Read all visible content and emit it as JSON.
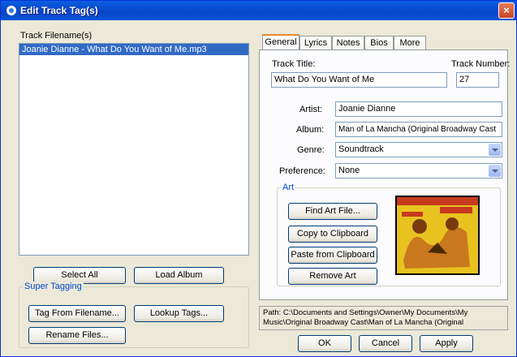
{
  "window": {
    "title": "Edit Track Tag(s)"
  },
  "files": {
    "label": "Track Filename(s)",
    "items": [
      "Joanie Dianne - What Do You Want of Me.mp3"
    ]
  },
  "buttons": {
    "select_all": "Select All",
    "load_album": "Load Album",
    "tag_from_filename": "Tag From Filename...",
    "lookup_tags": "Lookup Tags...",
    "rename_files": "Rename Files...",
    "find_art_file": "Find Art File...",
    "copy_to_clipboard": "Copy to Clipboard",
    "paste_from_clipboard": "Paste from Clipboard",
    "remove_art": "Remove Art",
    "ok": "OK",
    "cancel": "Cancel",
    "apply": "Apply"
  },
  "super_tagging": {
    "label": "Super Tagging"
  },
  "tabs": [
    "General",
    "Lyrics",
    "Notes",
    "Bios",
    "More"
  ],
  "general": {
    "track_title_label": "Track Title:",
    "track_title_value": "What Do You Want of Me",
    "track_number_label": "Track Number:",
    "track_number_value": "27",
    "artist_label": "Artist:",
    "artist_value": "Joanie Dianne",
    "album_label": "Album:",
    "album_value": "Man of La Mancha (Original Broadway Cast",
    "genre_label": "Genre:",
    "genre_value": "Soundtrack",
    "preference_label": "Preference:",
    "preference_value": "None",
    "art_label": "Art"
  },
  "path": {
    "text": "Path: C:\\Documents and Settings\\Owner\\My Documents\\My Music\\Original Broadway Cast\\Man of La Mancha (Original"
  },
  "colors": {
    "title_bar": "#0a4ccf",
    "selection": "#316ac5",
    "tab_accent": "#e68b2c"
  }
}
